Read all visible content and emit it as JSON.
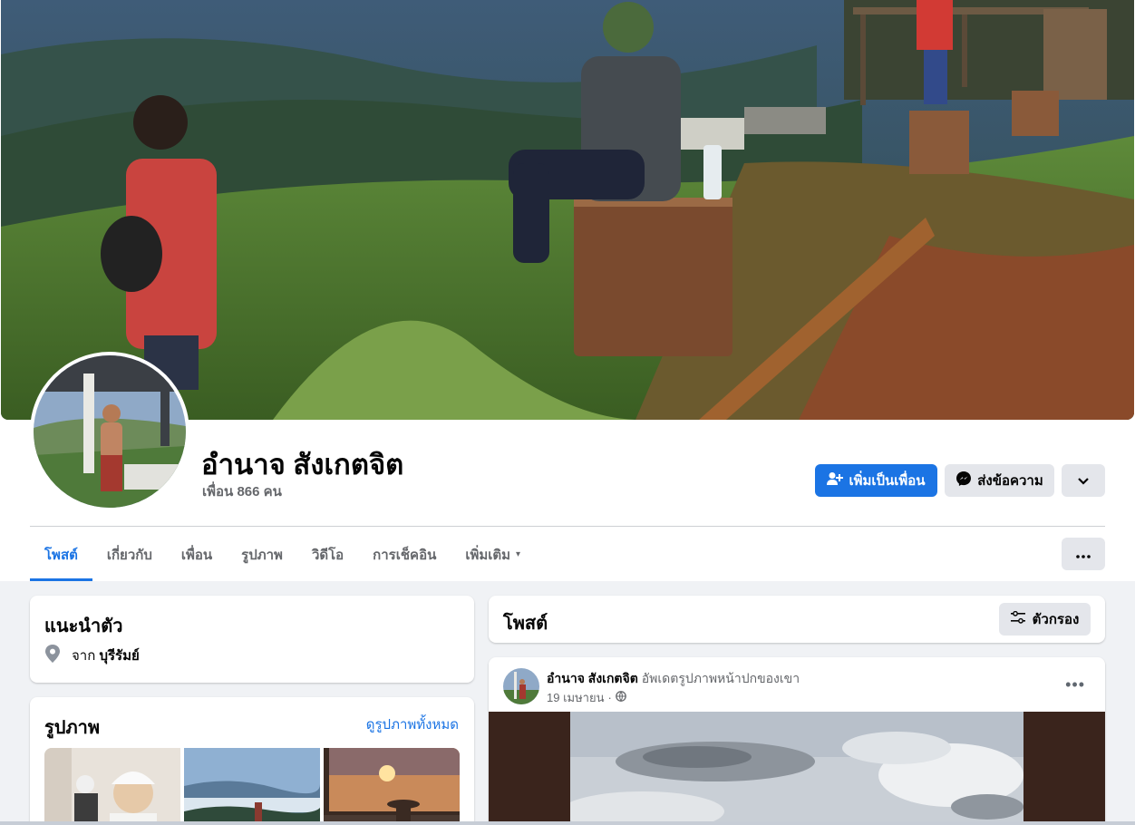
{
  "profile": {
    "name": "อำนาจ สังเกตจิต",
    "friends": "เพื่อน 866 คน"
  },
  "actions": {
    "add_friend": "เพิ่มเป็นเพื่อน",
    "message": "ส่งข้อความ",
    "add_friend_icon": "person-add-icon",
    "message_icon": "messenger-icon",
    "dropdown_icon": "chevron-down-icon",
    "more_icon": "more-dots-icon"
  },
  "tabs": [
    {
      "label": "โพสต์",
      "active": true
    },
    {
      "label": "เกี่ยวกับ"
    },
    {
      "label": "เพื่อน"
    },
    {
      "label": "รูปภาพ"
    },
    {
      "label": "วิดีโอ"
    },
    {
      "label": "การเช็คอิน"
    },
    {
      "label": "เพิ่มเติม",
      "caret": "▾"
    }
  ],
  "intro": {
    "title": "แนะนำตัว",
    "from_prefix": "จาก",
    "from_place": "บุรีรัมย์",
    "icon": "location-pin-icon"
  },
  "photos": {
    "title": "รูปภาพ",
    "see_all": "ดูรูปภาพทั้งหมด"
  },
  "posts": {
    "title": "โพสต์",
    "filter_label": "ตัวกรอง",
    "filter_icon": "filter-sliders-icon"
  },
  "post": {
    "author": "อำนาจ สังเกตจิต",
    "action": "อัพเดตรูปภาพหน้าปกของเขา",
    "date": "19 เมษายน",
    "separator": "·",
    "privacy_icon": "globe-icon",
    "menu": "•••"
  },
  "colors": {
    "accent": "#1b74e4",
    "background": "#f0f2f5",
    "button_gray": "#e4e6eb",
    "secondary_text": "#65676b"
  }
}
